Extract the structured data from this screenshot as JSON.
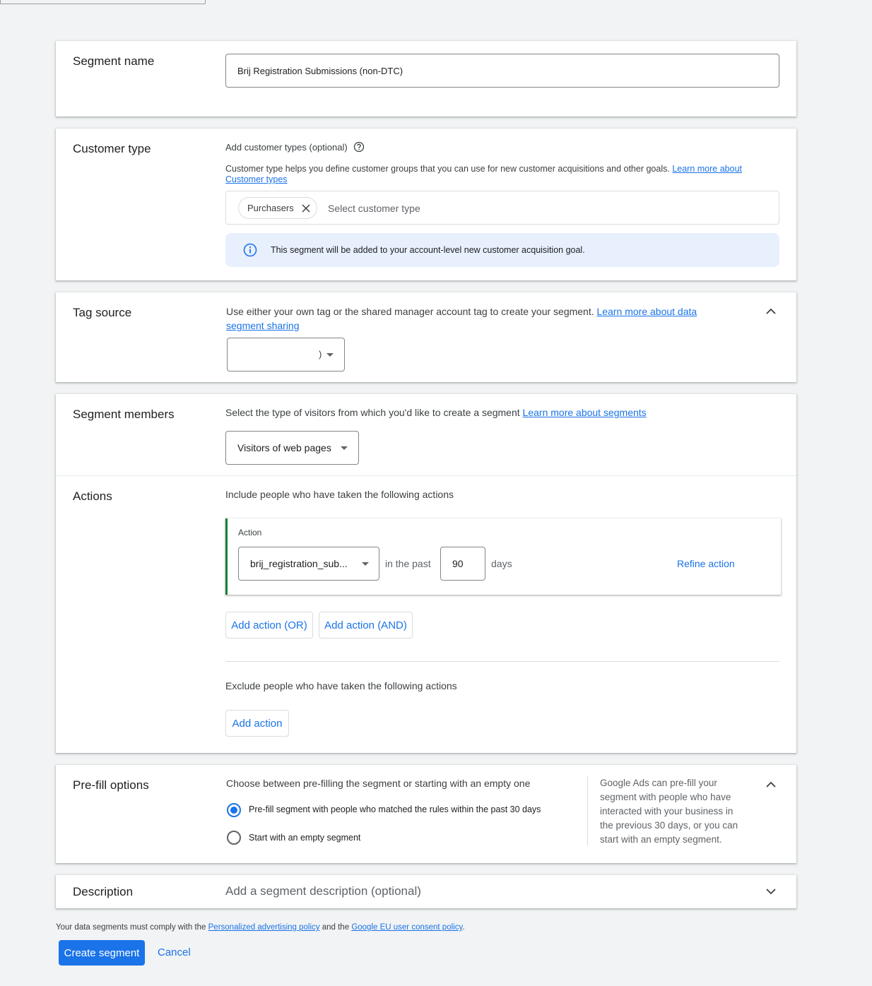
{
  "segment_name": {
    "label": "Segment name",
    "value": "Brij Registration Submissions (non-DTC)"
  },
  "customer_type": {
    "label": "Customer type",
    "subtitle": "Add customer types (optional)",
    "description": "Customer type helps you define customer groups that you can use for new customer acquisitions and other goals.",
    "link_line1": "Learn more about",
    "link_line2": "Customer types",
    "chip": "Purchasers",
    "placeholder": "Select customer type",
    "info": "This segment will be added to your account-level new customer acquisition goal."
  },
  "tag_source": {
    "label": "Tag source",
    "description": "Use either your own tag or the shared manager account tag to create your segment.",
    "link_line1": "Learn more about data",
    "link_line2": "segment sharing",
    "select_value": ")"
  },
  "segment_members": {
    "label": "Segment members",
    "description": "Select the type of visitors from which you'd like to create a segment",
    "link": "Learn more about segments",
    "select_value": "Visitors of web pages"
  },
  "actions": {
    "label": "Actions",
    "include_text": "Include people who have taken the following actions",
    "action_label": "Action",
    "action_value": "brij_registration_sub...",
    "in_the_past": "in the past",
    "days_value": "90",
    "days": "days",
    "refine": "Refine action",
    "add_or": "Add action (OR)",
    "add_and": "Add action (AND)",
    "exclude_text": "Exclude people who have taken the following actions",
    "add_action": "Add action"
  },
  "prefill": {
    "label": "Pre-fill options",
    "description": "Choose between pre-filling the segment or starting with an empty one",
    "option1": "Pre-fill segment with people who matched the rules within the past 30 days",
    "option2": "Start with an empty segment",
    "selected": "option1",
    "help_line1": "Google Ads can pre-fill your",
    "help_line2": "segment with people who have",
    "help_line3": "interacted with your business in",
    "help_line4": "the previous 30 days, or you can",
    "help_line5": "start with an empty segment."
  },
  "description": {
    "label": "Description",
    "placeholder": "Add a segment description (optional)"
  },
  "footer": {
    "policy_prefix": "Your data segments must comply with the",
    "policy_link1": "Personalized advertising policy",
    "policy_mid": "and the",
    "policy_link2": "Google EU user consent policy",
    "policy_suffix": ".",
    "create": "Create segment",
    "cancel": "Cancel"
  },
  "colors": {
    "accent": "#1a73e8",
    "action_border": "#188038",
    "info_bg": "#e8f0fe",
    "page_bg": "#f1f3f4"
  }
}
